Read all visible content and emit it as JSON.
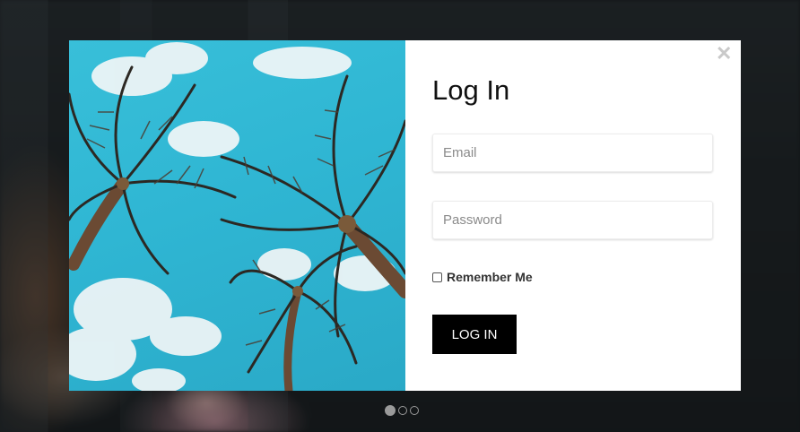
{
  "modal": {
    "title": "Log In",
    "close_icon": "close-icon",
    "image": {
      "description_icon": "palm-trees-photo"
    },
    "email": {
      "placeholder": "Email",
      "value": ""
    },
    "password": {
      "placeholder": "Password",
      "value": ""
    },
    "remember": {
      "label": "Remember Me",
      "checked": false
    },
    "submit_label": "LOG IN"
  },
  "carousel": {
    "dots": 3,
    "active_index": 0
  },
  "colors": {
    "button_bg": "#000000",
    "button_text": "#ffffff",
    "sky": "#38bfd9",
    "close_icon": "#c9c9c9"
  }
}
